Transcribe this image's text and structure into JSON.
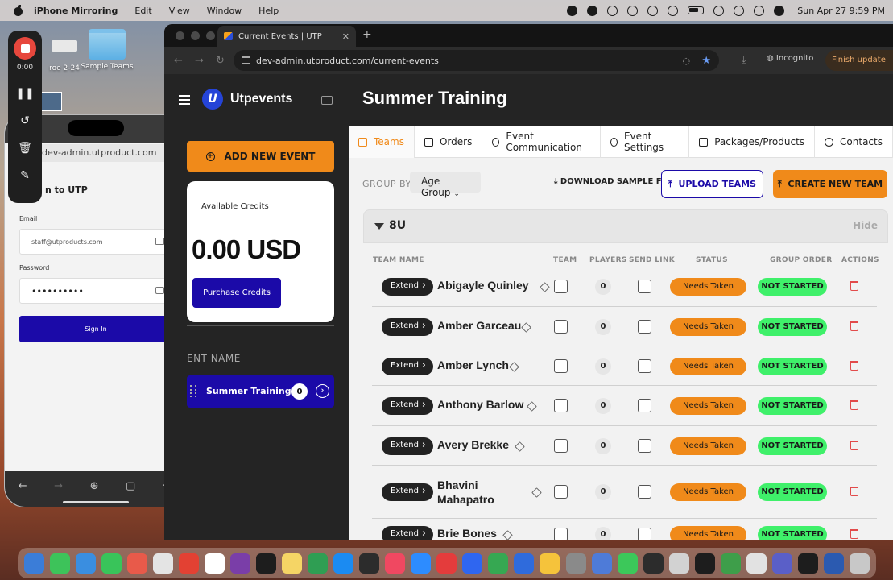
{
  "menubar": {
    "app_name": "iPhone Mirroring",
    "menus": [
      "Edit",
      "View",
      "Window",
      "Help"
    ],
    "clock": "Sun Apr 27  9:59 PM"
  },
  "desktop": {
    "file1": "roe 2-24",
    "folder": "Sample Teams"
  },
  "recorder": {
    "time": "0:00"
  },
  "phone": {
    "url": "dev-admin.utproduct.com",
    "title": "n to UTP",
    "email_label": "Email",
    "email_value": "staff@utproducts.com",
    "password_label": "Password",
    "password_value": "••••••••••",
    "signin_label": "Sign In"
  },
  "browser": {
    "tab_title": "Current Events | UTP",
    "url": "dev-admin.utproduct.com/current-events",
    "incognito": "Incognito",
    "finish_update": "Finish update"
  },
  "sidebar": {
    "brand": "Utpevents",
    "add_event": "ADD NEW EVENT",
    "credits_caption": "Available Credits",
    "credits_amount": "0.00 USD",
    "purchase": "Purchase Credits",
    "event_name_header": "ENT NAME",
    "event_item": {
      "name": "Summer Training",
      "count": "0"
    }
  },
  "main": {
    "title": "Summer Training",
    "tabs": [
      "Teams",
      "Orders",
      "Event Communication",
      "Event Settings",
      "Packages/Products",
      "Contacts"
    ],
    "group_by_label": "GROUP BY:",
    "group_by_value": "Age Group",
    "download_sample": "DOWNLOAD SAMPLE FILE",
    "upload_teams": "UPLOAD TEAMS",
    "create_team": "CREATE NEW TEAM",
    "group_name": "8U",
    "hide": "Hide",
    "columns": [
      "TEAM NAME",
      "TEAM",
      "PLAYERS",
      "SEND LINK",
      "STATUS",
      "GROUP ORDER",
      "ACTIONS"
    ],
    "extend_label": "Extend",
    "rows": [
      {
        "name": "Abigayle Quinley",
        "players": "0",
        "status": "Needs Taken",
        "order": "NOT STARTED"
      },
      {
        "name": "Amber Garceau",
        "players": "0",
        "status": "Needs Taken",
        "order": "NOT STARTED"
      },
      {
        "name": "Amber Lynch",
        "players": "0",
        "status": "Needs Taken",
        "order": "NOT STARTED"
      },
      {
        "name": "Anthony Barlow",
        "players": "0",
        "status": "Needs Taken",
        "order": "NOT STARTED"
      },
      {
        "name": "Avery Brekke",
        "players": "0",
        "status": "Needs Taken",
        "order": "NOT STARTED"
      },
      {
        "name": "Bhavini Mahapatro",
        "players": "0",
        "status": "Needs Taken",
        "order": "NOT STARTED"
      },
      {
        "name": "Brie Bones",
        "players": "0",
        "status": "Needs Taken",
        "order": "NOT STARTED"
      }
    ]
  },
  "dock": {
    "colors": [
      "#3b7dd8",
      "#3dc35a",
      "#3a8ee0",
      "#39c45a",
      "#e85a4a",
      "#e4e4e4",
      "#e34133",
      "#ffffff",
      "#7a3ea8",
      "#1d1d1d",
      "#f5d565",
      "#2f9e53",
      "#1b8bf2",
      "#2c2c2c",
      "#f04861",
      "#2d8cff",
      "#e43c3c",
      "#2f66f0",
      "#36a852",
      "#2f6bdc",
      "#f5c33b",
      "#8a8a8a",
      "#4e7bd8",
      "#3cc85a",
      "#2c2c2c",
      "#d2d2d2",
      "#1d1d1d",
      "#3e9e4a",
      "#e2e2e2",
      "#5a5fc8",
      "#1d1d1d",
      "#2b5ab0",
      "#c8c8c8"
    ]
  }
}
